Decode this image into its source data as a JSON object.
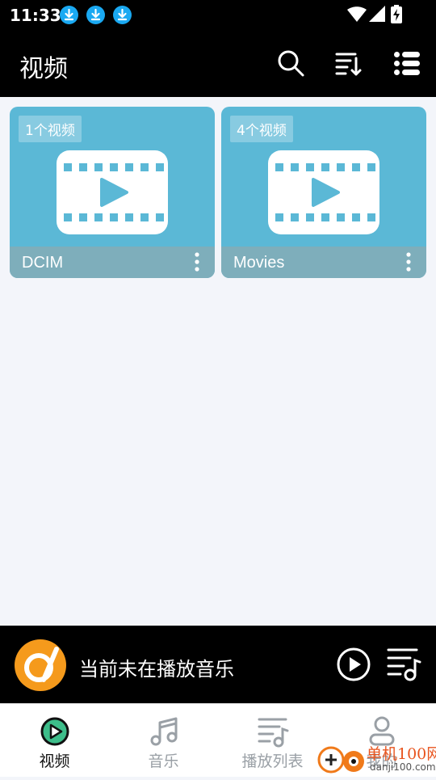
{
  "status_bar": {
    "time": "11:33",
    "notification_icons": [
      "download-icon",
      "download-icon",
      "download-icon"
    ],
    "system_icons": [
      "wifi-icon",
      "signal-icon",
      "battery-charging-icon"
    ]
  },
  "app_bar": {
    "title": "视频",
    "actions": [
      "search-icon",
      "sort-icon",
      "list-view-icon"
    ]
  },
  "folders": [
    {
      "name": "DCIM",
      "count_label": "1个视频"
    },
    {
      "name": "Movies",
      "count_label": "4个视频"
    }
  ],
  "mini_player": {
    "status_text": "当前未在播放音乐",
    "icons": [
      "album-disc-icon",
      "play-icon",
      "playlist-music-icon"
    ]
  },
  "bottom_nav": {
    "tabs": [
      {
        "label": "视频",
        "icon": "video-play-icon",
        "active": true
      },
      {
        "label": "音乐",
        "icon": "music-note-icon",
        "active": false
      },
      {
        "label": "播放列表",
        "icon": "playlist-icon",
        "active": false
      },
      {
        "label": "我的",
        "icon": "person-icon",
        "active": false
      }
    ]
  },
  "watermark": {
    "line1": "单机100网",
    "line2": "danji100.com"
  },
  "colors": {
    "accent": "#3dbd8a",
    "card_bg": "#5bb8d6",
    "card_footer": "#7eaebb",
    "header_bg": "#000000",
    "content_bg": "#f3f5fa",
    "download_badge": "#1aa9f2",
    "disc_orange": "#f59a1c"
  }
}
